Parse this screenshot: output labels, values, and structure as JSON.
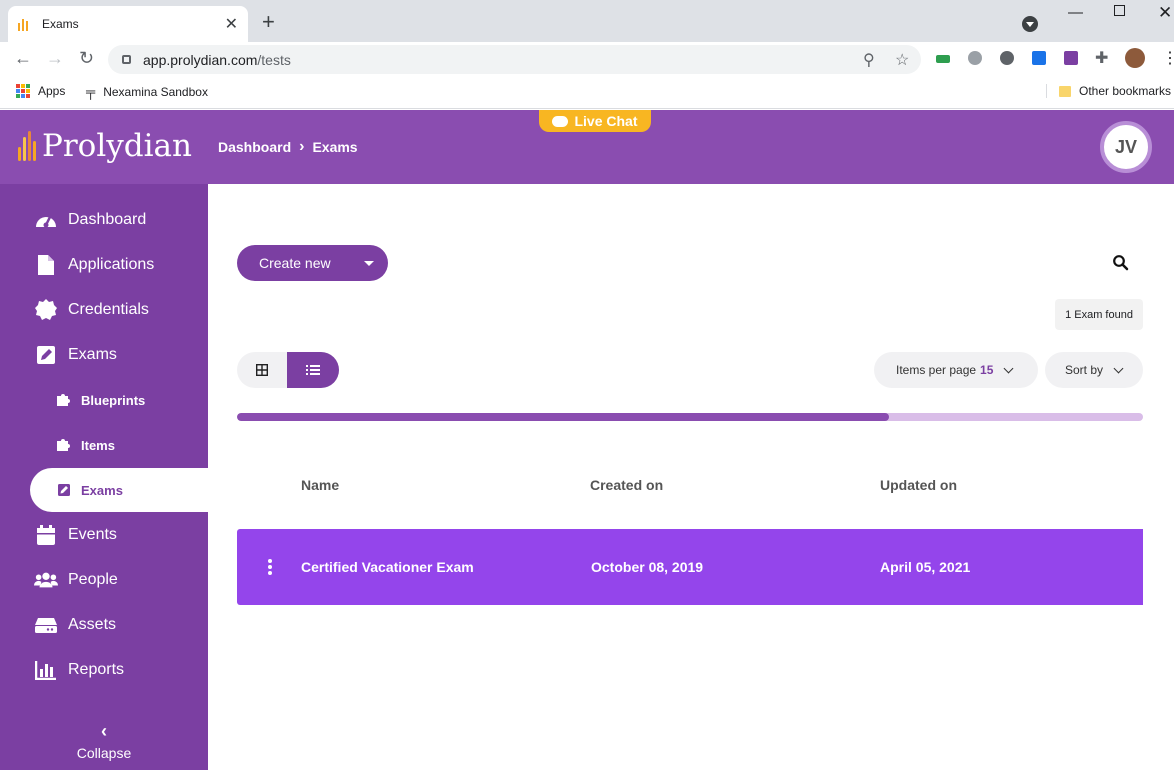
{
  "browser": {
    "tab_title": "Exams",
    "tab_close": "✕",
    "new_tab": "+",
    "url_host": "app.prolydian.com",
    "url_path": "/tests",
    "bookmarks": {
      "apps": "Apps",
      "sandbox": "Nexamina Sandbox",
      "other": "Other bookmarks"
    }
  },
  "app": {
    "brand": "Prolydian",
    "breadcrumb": [
      "Dashboard",
      "Exams"
    ],
    "live_chat": "Live Chat",
    "user_initials": "JV",
    "colors": {
      "primary": "#7b3fa2",
      "header": "#8a4db0",
      "row": "#9445eb",
      "chat": "#f8b622"
    }
  },
  "sidebar": {
    "items": [
      {
        "label": "Dashboard",
        "icon": "gauge-icon"
      },
      {
        "label": "Applications",
        "icon": "file-icon"
      },
      {
        "label": "Credentials",
        "icon": "badge-icon"
      },
      {
        "label": "Exams",
        "icon": "edit-icon"
      },
      {
        "label": "Blueprints",
        "icon": "puzzle-icon"
      },
      {
        "label": "Items",
        "icon": "puzzle-icon"
      },
      {
        "label": "Exams",
        "icon": "edit-icon"
      },
      {
        "label": "Events",
        "icon": "calendar-icon"
      },
      {
        "label": "People",
        "icon": "people-icon"
      },
      {
        "label": "Assets",
        "icon": "drive-icon"
      },
      {
        "label": "Reports",
        "icon": "chart-icon"
      }
    ],
    "collapse": "Collapse",
    "collapse_arrow": "‹"
  },
  "main": {
    "create_new": "Create new",
    "found_text": "1 Exam found",
    "items_per_page_label": "Items per page",
    "items_per_page_value": "15",
    "sort_by": "Sort by",
    "progress": 0.72,
    "columns": [
      "Name",
      "Created on",
      "Updated on"
    ],
    "rows": [
      {
        "name": "Certified Vacationer Exam",
        "created": "October 08, 2019",
        "updated": "April 05, 2021"
      }
    ]
  }
}
